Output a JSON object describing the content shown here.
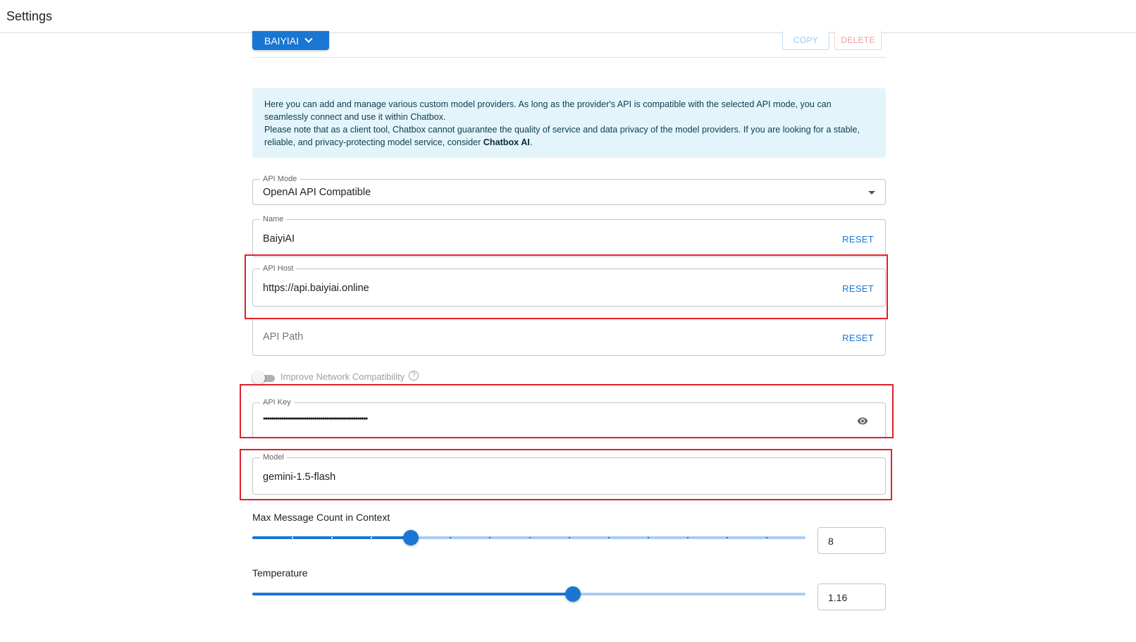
{
  "header": {
    "title": "Settings"
  },
  "provider": {
    "selected": "BAIYIAI",
    "copy_label": "COPY",
    "delete_label": "DELETE"
  },
  "info": {
    "line1": "Here you can add and manage various custom model providers. As long as the provider's API is compatible with the selected API mode, you can seamlessly connect and use it within Chatbox.",
    "line2_prefix": "Please note that as a client tool, Chatbox cannot guarantee the quality of service and data privacy of the model providers. If you are looking for a stable, reliable, and privacy-protecting model service, consider ",
    "line2_bold": "Chatbox AI",
    "line2_suffix": "."
  },
  "form": {
    "api_mode": {
      "label": "API Mode",
      "value": "OpenAI API Compatible"
    },
    "name": {
      "label": "Name",
      "value": "BaiyiAI",
      "reset": "RESET"
    },
    "api_host": {
      "label": "API Host",
      "value": "https://api.baiyiai.online",
      "reset": "RESET"
    },
    "api_path": {
      "placeholder": "API Path",
      "reset": "RESET"
    },
    "network_toggle": {
      "label": "Improve Network Compatibility",
      "help_icon": "?",
      "enabled": false
    },
    "api_key": {
      "label": "API Key",
      "value": "•••••••••••••••••••••••••••••••••••••••••••••••••••",
      "icon": "eye-icon"
    },
    "model": {
      "label": "Model",
      "value": "gemini-1.5-flash"
    }
  },
  "sliders": {
    "max_message": {
      "label": "Max Message Count in Context",
      "value": "8",
      "fraction": 0.286,
      "marks": 14
    },
    "temperature": {
      "label": "Temperature",
      "value": "1.16",
      "fraction": 0.58
    }
  },
  "colors": {
    "accent": "#1976d2",
    "highlight": "#e0202a",
    "info_bg": "#e3f5fb"
  }
}
